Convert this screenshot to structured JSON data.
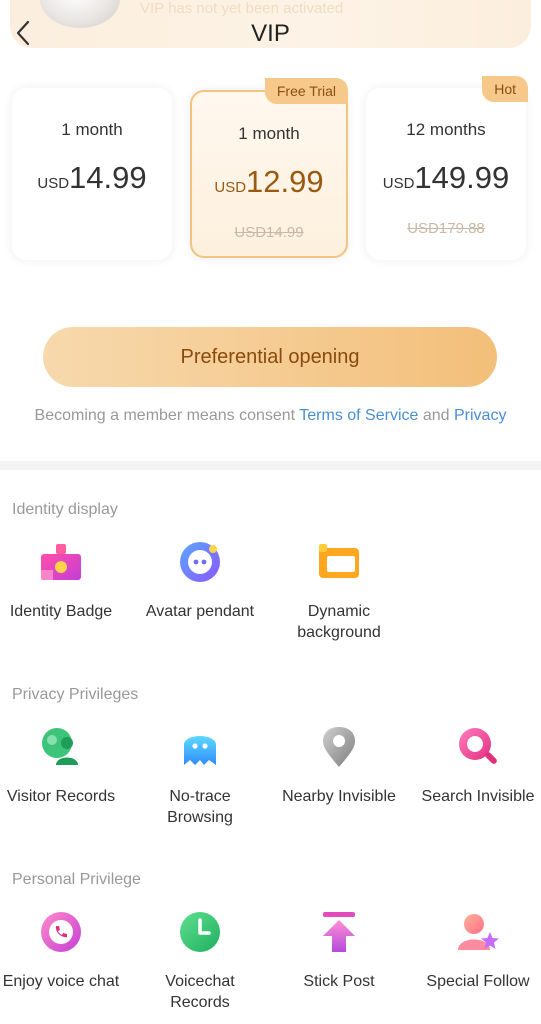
{
  "banner": {
    "status_text": "VIP has not yet been activated"
  },
  "header": {
    "title": "VIP"
  },
  "plans": [
    {
      "name": "1 month",
      "currency": "USD",
      "price": "14.99",
      "original_price": "",
      "tag": ""
    },
    {
      "name": "1 month",
      "currency": "USD",
      "price": "12.99",
      "original_price": "USD14.99",
      "tag": "Free Trial",
      "selected": true
    },
    {
      "name": "12 months",
      "currency": "USD",
      "price": "149.99",
      "original_price": "USD179.88",
      "tag": "Hot"
    }
  ],
  "cta": {
    "label": "Preferential opening"
  },
  "consent": {
    "prefix": "Becoming a member means consent ",
    "terms_link": "Terms of Service",
    "and_text": " and ",
    "privacy_link": "Privacy"
  },
  "sections": [
    {
      "title": "Identity display",
      "features": [
        {
          "label": "Identity Badge",
          "icon": "identity-badge-icon"
        },
        {
          "label": "Avatar pendant",
          "icon": "avatar-pendant-icon"
        },
        {
          "label": "Dynamic background",
          "icon": "dynamic-background-icon"
        }
      ]
    },
    {
      "title": "Privacy Privileges",
      "features": [
        {
          "label": "Visitor Records",
          "icon": "visitor-records-icon"
        },
        {
          "label": "No-trace Browsing",
          "icon": "no-trace-browsing-icon"
        },
        {
          "label": "Nearby Invisible",
          "icon": "nearby-invisible-icon"
        },
        {
          "label": "Search Invisible",
          "icon": "search-invisible-icon"
        }
      ]
    },
    {
      "title": "Personal Privilege",
      "features": [
        {
          "label": "Enjoy voice chat",
          "icon": "voice-chat-icon"
        },
        {
          "label": "Voicechat Records",
          "icon": "voicechat-records-icon"
        },
        {
          "label": "Stick Post",
          "icon": "stick-post-icon"
        },
        {
          "label": "Special Follow",
          "icon": "special-follow-icon"
        }
      ]
    }
  ],
  "colors": {
    "accent": "#f3bf7a",
    "accent_text": "#8a4a0d",
    "link": "#4a8fd6"
  }
}
